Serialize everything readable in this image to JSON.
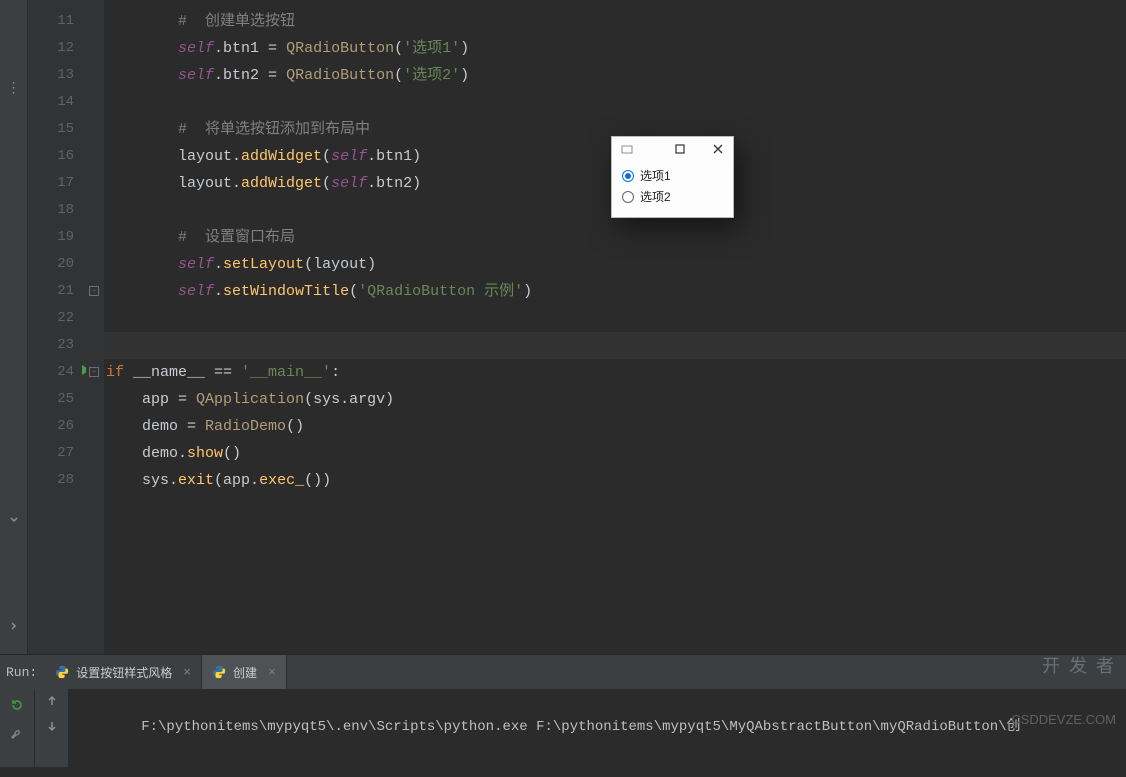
{
  "lines": [
    {
      "n": 11,
      "indent": 8,
      "tokens": [
        [
          "comment",
          "#  创建单选按钮"
        ]
      ]
    },
    {
      "n": 12,
      "indent": 8,
      "tokens": [
        [
          "self",
          "self"
        ],
        [
          "white",
          ".btn1 "
        ],
        [
          "white",
          "= "
        ],
        [
          "call",
          "QRadioButton"
        ],
        [
          "white",
          "("
        ],
        [
          "str",
          "'选项1'"
        ],
        [
          "white",
          ")"
        ]
      ]
    },
    {
      "n": 13,
      "indent": 8,
      "tokens": [
        [
          "self",
          "self"
        ],
        [
          "white",
          ".btn2 "
        ],
        [
          "white",
          "= "
        ],
        [
          "call",
          "QRadioButton"
        ],
        [
          "white",
          "("
        ],
        [
          "str",
          "'选项2'"
        ],
        [
          "white",
          ")"
        ]
      ]
    },
    {
      "n": 14,
      "indent": 0,
      "tokens": []
    },
    {
      "n": 15,
      "indent": 8,
      "tokens": [
        [
          "comment",
          "#  将单选按钮添加到布局中"
        ]
      ]
    },
    {
      "n": 16,
      "indent": 8,
      "tokens": [
        [
          "white",
          "layout."
        ],
        [
          "func",
          "addWidget"
        ],
        [
          "white",
          "("
        ],
        [
          "self",
          "self"
        ],
        [
          "white",
          ".btn1)"
        ]
      ]
    },
    {
      "n": 17,
      "indent": 8,
      "tokens": [
        [
          "white",
          "layout."
        ],
        [
          "func",
          "addWidget"
        ],
        [
          "white",
          "("
        ],
        [
          "self",
          "self"
        ],
        [
          "white",
          ".btn2)"
        ]
      ]
    },
    {
      "n": 18,
      "indent": 0,
      "tokens": []
    },
    {
      "n": 19,
      "indent": 8,
      "tokens": [
        [
          "comment",
          "#  设置窗口布局"
        ]
      ]
    },
    {
      "n": 20,
      "indent": 8,
      "tokens": [
        [
          "self",
          "self"
        ],
        [
          "white",
          "."
        ],
        [
          "func",
          "setLayout"
        ],
        [
          "white",
          "(layout)"
        ]
      ]
    },
    {
      "n": 21,
      "indent": 8,
      "tokens": [
        [
          "self",
          "self"
        ],
        [
          "white",
          "."
        ],
        [
          "func",
          "setWindowTitle"
        ],
        [
          "white",
          "("
        ],
        [
          "str",
          "'QRadioButton 示例'"
        ],
        [
          "white",
          ")"
        ]
      ]
    },
    {
      "n": 22,
      "indent": 0,
      "tokens": []
    },
    {
      "n": 23,
      "indent": 0,
      "tokens": [],
      "hl": true
    },
    {
      "n": 24,
      "indent": 0,
      "tokens": [
        [
          "key",
          "if "
        ],
        [
          "white",
          "__name__ "
        ],
        [
          "white",
          "== "
        ],
        [
          "str",
          "'__main__'"
        ],
        [
          "white",
          ":"
        ]
      ],
      "run": true
    },
    {
      "n": 25,
      "indent": 4,
      "tokens": [
        [
          "white",
          "app "
        ],
        [
          "white",
          "= "
        ],
        [
          "call",
          "QApplication"
        ],
        [
          "white",
          "(sys.argv)"
        ]
      ]
    },
    {
      "n": 26,
      "indent": 4,
      "tokens": [
        [
          "white",
          "demo "
        ],
        [
          "white",
          "= "
        ],
        [
          "call",
          "RadioDemo"
        ],
        [
          "white",
          "()"
        ]
      ]
    },
    {
      "n": 27,
      "indent": 4,
      "tokens": [
        [
          "white",
          "demo."
        ],
        [
          "func",
          "show"
        ],
        [
          "white",
          "()"
        ]
      ]
    },
    {
      "n": 28,
      "indent": 4,
      "tokens": [
        [
          "white",
          "sys."
        ],
        [
          "func",
          "exit"
        ],
        [
          "white",
          "(app."
        ],
        [
          "func",
          "exec_"
        ],
        [
          "white",
          "())"
        ]
      ]
    }
  ],
  "popup": {
    "radio1": "选项1",
    "radio2": "选项2"
  },
  "run_label": "Run:",
  "tabs": [
    {
      "label": "设置按钮样式风格",
      "active": false
    },
    {
      "label": "创建",
      "active": true
    }
  ],
  "console_out": "F:\\pythonitems\\mypyqt5\\.env\\Scripts\\python.exe F:\\pythonitems\\mypyqt5\\MyQAbstractButton\\myQRadioButton\\创",
  "watermark_l1": "开 发 者",
  "watermark_l2": "CSDDEVZE.COM",
  "classmap": {
    "comment": "k-comment",
    "self": "k-self",
    "white": "k-white",
    "call": "k-call",
    "func": "k-func",
    "str": "k-str",
    "key": "k-key",
    "purple": "k-purple"
  }
}
